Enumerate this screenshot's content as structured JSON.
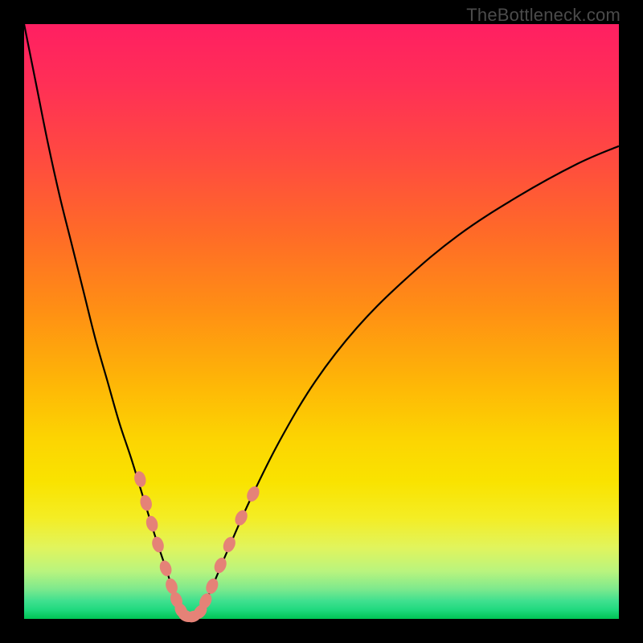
{
  "watermark": "TheBottleneck.com",
  "chart_data": {
    "type": "line",
    "title": "",
    "xlabel": "",
    "ylabel": "",
    "xlim": [
      0,
      100
    ],
    "ylim": [
      0,
      100
    ],
    "grid": false,
    "legend": false,
    "notes": "V-shaped bottleneck curve over a vertical color gradient (red at top indicating high bottleneck, green at bottom indicating low bottleneck). No numeric axis ticks are visible; x/y units are relative fractions of the plot area. Salmon-colored oval markers highlight the near-optimal region around the valley floor.",
    "series": [
      {
        "name": "left-branch",
        "x": [
          0.0,
          2.0,
          4.0,
          6.0,
          8.0,
          10.0,
          12.0,
          14.0,
          16.0,
          18.0,
          20.0,
          22.0,
          24.0,
          25.5,
          27.0
        ],
        "y": [
          100.0,
          90.0,
          80.0,
          71.0,
          63.0,
          55.0,
          47.0,
          40.0,
          33.0,
          27.0,
          20.5,
          14.0,
          8.0,
          3.5,
          0.5
        ]
      },
      {
        "name": "right-branch",
        "x": [
          29.0,
          31.0,
          34.0,
          38.0,
          43.0,
          49.0,
          56.0,
          64.0,
          73.0,
          83.0,
          93.0,
          100.0
        ],
        "y": [
          0.5,
          4.0,
          11.0,
          20.0,
          30.0,
          40.0,
          49.0,
          57.0,
          64.5,
          71.0,
          76.5,
          79.5
        ]
      },
      {
        "name": "valley-floor",
        "x": [
          27.0,
          28.0,
          29.0
        ],
        "y": [
          0.5,
          0.3,
          0.5
        ]
      }
    ],
    "markers": [
      {
        "branch": "left",
        "x": 19.5,
        "y": 23.5
      },
      {
        "branch": "left",
        "x": 20.5,
        "y": 19.5
      },
      {
        "branch": "left",
        "x": 21.5,
        "y": 16.0
      },
      {
        "branch": "left",
        "x": 22.5,
        "y": 12.5
      },
      {
        "branch": "left",
        "x": 23.8,
        "y": 8.5
      },
      {
        "branch": "left",
        "x": 24.8,
        "y": 5.5
      },
      {
        "branch": "left",
        "x": 25.6,
        "y": 3.2
      },
      {
        "branch": "left",
        "x": 26.4,
        "y": 1.4
      },
      {
        "branch": "floor",
        "x": 27.2,
        "y": 0.5
      },
      {
        "branch": "floor",
        "x": 28.4,
        "y": 0.4
      },
      {
        "branch": "right",
        "x": 29.6,
        "y": 1.2
      },
      {
        "branch": "right",
        "x": 30.5,
        "y": 3.0
      },
      {
        "branch": "right",
        "x": 31.6,
        "y": 5.5
      },
      {
        "branch": "right",
        "x": 33.0,
        "y": 9.0
      },
      {
        "branch": "right",
        "x": 34.5,
        "y": 12.5
      },
      {
        "branch": "right",
        "x": 36.5,
        "y": 17.0
      },
      {
        "branch": "right",
        "x": 38.5,
        "y": 21.0
      }
    ]
  }
}
